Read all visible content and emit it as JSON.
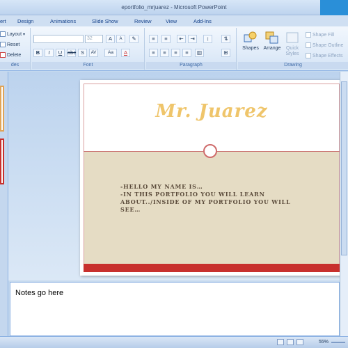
{
  "window": {
    "title": "eportfolio_mrjuarez - Microsoft PowerPoint"
  },
  "tabs": [
    "ert",
    "Design",
    "Animations",
    "Slide Show",
    "Review",
    "View",
    "Add-Ins"
  ],
  "ribbon": {
    "slides_group": {
      "layout": "Layout",
      "reset": "Reset",
      "delete": "Delete",
      "label": "des"
    },
    "font_group": {
      "label": "Font",
      "size_value": "32"
    },
    "paragraph_group": {
      "label": "Paragraph"
    },
    "drawing_group": {
      "label": "Drawing",
      "shapes": "Shapes",
      "arrange": "Arrange",
      "quick_styles": "Quick Styles",
      "shape_fill": "Shape Fill",
      "shape_outline": "Shape Outline",
      "shape_effects": "Shape Effects"
    }
  },
  "slide": {
    "title": "Mr. Juarez",
    "body_lines": [
      "-Hello my name is…",
      "-In this portfolio you will learn about../inside of my portfolio you will see…"
    ]
  },
  "notes": {
    "text": "Notes go here"
  },
  "status": {
    "zoom": "55%"
  },
  "colors": {
    "title_gold": "#efc56b",
    "accent_red": "#c8302d",
    "content_beige": "#e5dcc4"
  }
}
